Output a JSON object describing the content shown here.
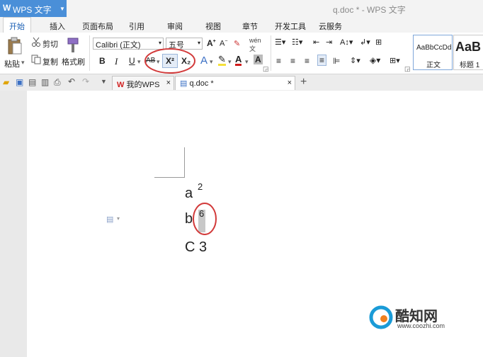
{
  "titlebar": {
    "app_name": "WPS 文字",
    "app_logo": "W",
    "document_title": "q.doc * - WPS 文字"
  },
  "menu_tabs": [
    "开始",
    "插入",
    "页面布局",
    "引用",
    "审阅",
    "视图",
    "章节",
    "开发工具",
    "云服务"
  ],
  "ribbon": {
    "paste_label": "粘贴",
    "cut_label": "剪切",
    "copy_label": "复制",
    "format_painter_label": "格式刷",
    "font_name": "Calibri (正文)",
    "font_size": "五号",
    "bold": "B",
    "italic": "I",
    "underline": "U",
    "strikethrough": "AB",
    "superscript": "X²",
    "subscript": "X₂",
    "styles": [
      {
        "preview": "AaBbCcDd",
        "label": "正文"
      },
      {
        "preview": "AaB",
        "label": "标题 1"
      }
    ]
  },
  "doc_tabs": [
    {
      "label": "我的WPS",
      "close": "×"
    },
    {
      "label": "q.doc *",
      "close": "×"
    }
  ],
  "new_tab": "+",
  "document": {
    "lines": [
      {
        "base": "a",
        "sup": "2"
      },
      {
        "base": "b",
        "sup": "6"
      },
      {
        "base": "C 3",
        "sup": ""
      }
    ]
  },
  "watermark": {
    "brand": "酷知网",
    "url": "www.coozhi.com"
  },
  "colors": {
    "accent": "#4a8fd8",
    "highlight_circle": "#d23a3a",
    "selection": "#c8c8c8"
  }
}
